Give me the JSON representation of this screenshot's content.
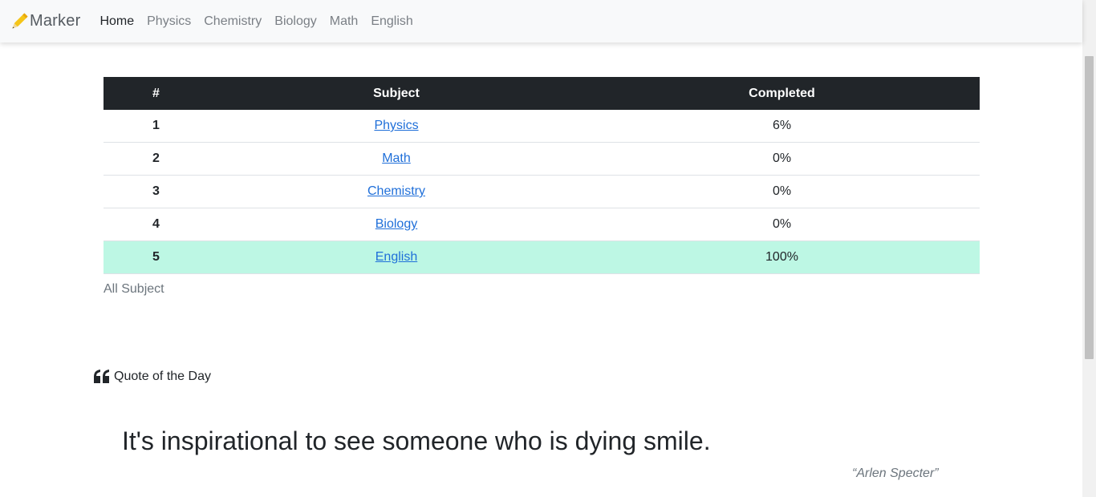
{
  "navbar": {
    "brand": "Marker",
    "links": [
      "Home",
      "Physics",
      "Chemistry",
      "Biology",
      "Math",
      "English"
    ],
    "active": "Home"
  },
  "table": {
    "headers": [
      "#",
      "Subject",
      "Completed"
    ],
    "rows": [
      {
        "num": "1",
        "subject": "Physics",
        "completed": "6%"
      },
      {
        "num": "2",
        "subject": "Math",
        "completed": "0%"
      },
      {
        "num": "3",
        "subject": "Chemistry",
        "completed": "0%"
      },
      {
        "num": "4",
        "subject": "Biology",
        "completed": "0%"
      },
      {
        "num": "5",
        "subject": "English",
        "completed": "100%"
      }
    ],
    "caption": "All Subject",
    "highlight_color": "#bdf7e4"
  },
  "quote": {
    "title": "Quote of the Day",
    "text": "It's inspirational to see someone who is dying smile.",
    "author": "“Arlen Specter”"
  },
  "icons": {
    "brand": "pencil-icon",
    "quote": "quote-left-icon"
  },
  "colors": {
    "header_bg": "#212529",
    "link": "#1f6fd9",
    "brand_pencil": "#f5c518"
  }
}
